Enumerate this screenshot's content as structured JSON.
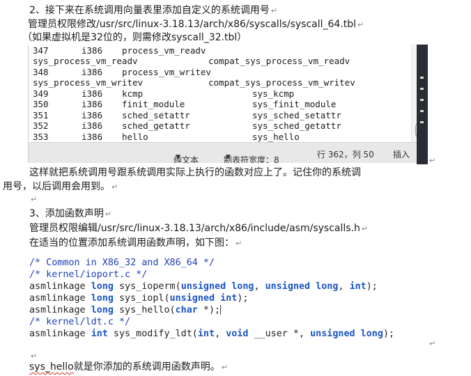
{
  "step2": {
    "title": "2、接下来在系统调用向量表里添加自定义的系统调用号",
    "line2": "管理员权限修改/usr/src/linux-3.18.13/arch/x86/syscalls/syscall_64.tbl",
    "line3": "（如果虚拟机是32位的，则需修改syscall_32.tbl）"
  },
  "editor": {
    "lines": [
      {
        "c1": "347",
        "c2": "i386",
        "c3": "process_vm_readv",
        "c4": ""
      },
      {
        "c1": "sys_process_vm_readv",
        "c2": "",
        "c3": "compat_sys_process_vm_readv",
        "c4": ""
      },
      {
        "c1": "348",
        "c2": "i386",
        "c3": "process_vm_writev",
        "c4": ""
      },
      {
        "c1": "sys_process_vm_writev",
        "c2": "",
        "c3": "compat_sys_process_vm_writev",
        "c4": ""
      },
      {
        "c1": "349",
        "c2": "i386",
        "c3": "kcmp",
        "c4": "sys_kcmp"
      },
      {
        "c1": "350",
        "c2": "i386",
        "c3": "finit_module",
        "c4": "sys_finit_module"
      },
      {
        "c1": "351",
        "c2": "i386",
        "c3": "sched_setattr",
        "c4": "sys_sched_setattr"
      },
      {
        "c1": "352",
        "c2": "i386",
        "c3": "sched_getattr",
        "c4": "sys_sched_getattr"
      },
      {
        "c1": "353",
        "c2": "i386",
        "c3": "hello",
        "c4": "sys_hello"
      }
    ],
    "status_mode": "纯文本",
    "status_tab": "制表符宽度：8",
    "status_pos": "行 362，列 50",
    "status_ins": "插入"
  },
  "para1": {
    "line1": "这样就把系统调用号跟系统调用实际上执行的函数对应上了。记住你的系统调",
    "line2": "用号，以后调用会用到。"
  },
  "step3": {
    "title": "3、添加函数声明",
    "line2": "管理员权限编辑/usr/src/linux-3.18.13/arch/x86/include/asm/syscalls.h",
    "line3": "在适当的位置添加系统调用函数声明，如下图："
  },
  "code": {
    "c1": "/* Common in X86_32 and X86_64 */",
    "c2": "/* kernel/ioport.c */",
    "l3": [
      "asmlinkage ",
      "long",
      " sys_ioperm(",
      "unsigned long",
      ", ",
      "unsigned long",
      ", ",
      "int",
      ");"
    ],
    "l4": [
      "asmlinkage ",
      "long",
      " sys_iopl(",
      "unsigned int",
      ");"
    ],
    "l5": [
      "asmlinkage ",
      "long",
      " sys_hello(",
      "char",
      " *);"
    ],
    "c6": "/* kernel/ldt.c */",
    "l7": [
      "asmlinkage ",
      "int",
      " sys_modify_ldt(",
      "int",
      ", ",
      "void",
      " __user *, ",
      "unsigned long",
      ");"
    ]
  },
  "footer": {
    "name": "sys_hello",
    "rest": "就是你添加的系统调用函数声明。"
  },
  "paragraph_mark": "↵"
}
